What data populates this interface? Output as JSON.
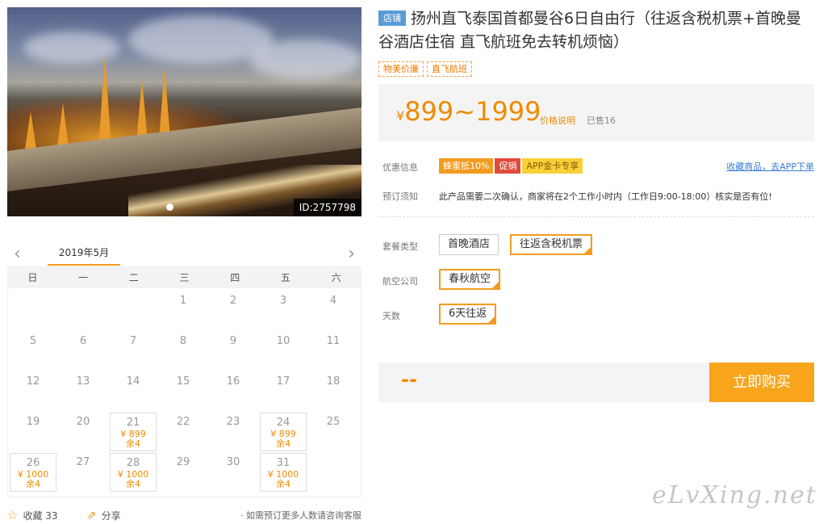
{
  "hero": {
    "image_id": "ID:2757798"
  },
  "calendar": {
    "month": "2019年5月",
    "weekdays": [
      "日",
      "一",
      "二",
      "三",
      "四",
      "五",
      "六"
    ],
    "days": [
      {
        "d": "",
        "p": "",
        "l": ""
      },
      {
        "d": "",
        "p": "",
        "l": ""
      },
      {
        "d": "",
        "p": "",
        "l": ""
      },
      {
        "d": "1",
        "p": "",
        "l": ""
      },
      {
        "d": "2",
        "p": "",
        "l": ""
      },
      {
        "d": "3",
        "p": "",
        "l": ""
      },
      {
        "d": "4",
        "p": "",
        "l": ""
      },
      {
        "d": "5",
        "p": "",
        "l": ""
      },
      {
        "d": "6",
        "p": "",
        "l": ""
      },
      {
        "d": "7",
        "p": "",
        "l": ""
      },
      {
        "d": "8",
        "p": "",
        "l": ""
      },
      {
        "d": "9",
        "p": "",
        "l": ""
      },
      {
        "d": "10",
        "p": "",
        "l": ""
      },
      {
        "d": "11",
        "p": "",
        "l": ""
      },
      {
        "d": "12",
        "p": "",
        "l": ""
      },
      {
        "d": "13",
        "p": "",
        "l": ""
      },
      {
        "d": "14",
        "p": "",
        "l": ""
      },
      {
        "d": "15",
        "p": "",
        "l": ""
      },
      {
        "d": "16",
        "p": "",
        "l": ""
      },
      {
        "d": "17",
        "p": "",
        "l": ""
      },
      {
        "d": "18",
        "p": "",
        "l": ""
      },
      {
        "d": "19",
        "p": "",
        "l": ""
      },
      {
        "d": "20",
        "p": "",
        "l": ""
      },
      {
        "d": "21",
        "p": "¥ 899",
        "l": "余4"
      },
      {
        "d": "22",
        "p": "",
        "l": ""
      },
      {
        "d": "23",
        "p": "",
        "l": ""
      },
      {
        "d": "24",
        "p": "¥ 899",
        "l": "余4"
      },
      {
        "d": "25",
        "p": "",
        "l": ""
      },
      {
        "d": "26",
        "p": "¥ 1000",
        "l": "余4"
      },
      {
        "d": "27",
        "p": "",
        "l": ""
      },
      {
        "d": "28",
        "p": "¥ 1000",
        "l": "余4"
      },
      {
        "d": "29",
        "p": "",
        "l": ""
      },
      {
        "d": "30",
        "p": "",
        "l": ""
      },
      {
        "d": "31",
        "p": "¥ 1000",
        "l": "余4"
      },
      {
        "d": "",
        "p": "",
        "l": ""
      }
    ],
    "favorite_label": "收藏 33",
    "share_label": "分享",
    "tip": "· 如需预订更多人数请咨询客服"
  },
  "product": {
    "shop_tag": "店铺",
    "title": "扬州直飞泰国首都曼谷6日自由行（往返含税机票+首晚曼谷酒店住宿 直飞航班免去转机烦恼）",
    "tags": [
      "物美价廉",
      "直飞航班"
    ],
    "price_currency": "¥",
    "price_range": "899~1999",
    "price_explain": "价格说明",
    "sold": "已售16",
    "promo_label": "优惠信息",
    "promos": [
      {
        "text": "蜂蜜抵10%",
        "color": "#f29c1f"
      },
      {
        "text": "促销",
        "color": "#e04a3a"
      },
      {
        "text": "APP金卡专享",
        "color": "#f7d03a"
      }
    ],
    "collect_link": "收藏商品，去APP下单",
    "notice_label": "预订须知",
    "notice": "此产品需要二次确认，商家将在2个工作小时内（工作日9:00-18:00）核实是否有位!",
    "package_label": "套餐类型",
    "package_options": [
      "首晚酒店",
      "往返含税机票"
    ],
    "airline_label": "航空公司",
    "airline_option": "春秋航空",
    "days_label": "天数",
    "days_option": "6天往返",
    "selected_price": "--",
    "buy_label": "立即购买"
  },
  "watermark": "eLvXing.net"
}
